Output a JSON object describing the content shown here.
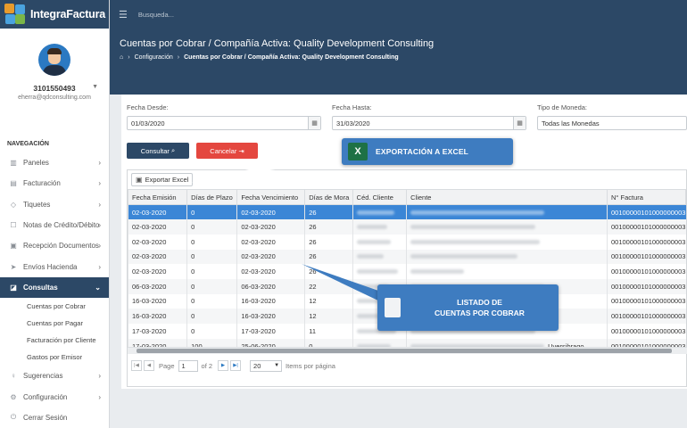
{
  "brand": {
    "name": "IntegraFactura"
  },
  "topbar": {
    "search_placeholder": "Busqueda..."
  },
  "user": {
    "id": "3101550493",
    "email": "eherra@qdconsulting.com"
  },
  "nav": {
    "heading": "NAVEGACIÓN",
    "items": [
      {
        "label": "Paneles",
        "icon": "chart-icon"
      },
      {
        "label": "Facturación",
        "icon": "invoice-icon"
      },
      {
        "label": "Tiquetes",
        "icon": "ticket-icon"
      },
      {
        "label": "Notas de Crédito/Débito",
        "icon": "notes-icon"
      },
      {
        "label": "Recepción Documentos",
        "icon": "inbox-icon"
      },
      {
        "label": "Envíos Hacienda",
        "icon": "send-icon"
      },
      {
        "label": "Consultas",
        "icon": "search-doc-icon"
      },
      {
        "label": "Sugerencias",
        "icon": "lightbulb-icon"
      },
      {
        "label": "Configuración",
        "icon": "gear-icon"
      },
      {
        "label": "Cerrar Sesión",
        "icon": "power-icon"
      }
    ],
    "subitems": [
      "Cuentas por Cobrar",
      "Cuentas por Pagar",
      "Facturación por Cliente",
      "Gastos por Emisor"
    ]
  },
  "page": {
    "title": "Cuentas por Cobrar / Compañía Activa: Quality Development Consulting",
    "breadcrumb_1": "Configuración",
    "breadcrumb_2": "Cuentas por Cobrar / Compañía Activa: Quality Development Consulting"
  },
  "filters": {
    "desde_label": "Fecha Desde:",
    "desde_value": "01/03/2020",
    "hasta_label": "Fecha Hasta:",
    "hasta_value": "31/03/2020",
    "moneda_label": "Tipo de Moneda:",
    "moneda_value": "Todas las Monedas",
    "consultar": "Consultar",
    "cancelar": "Cancelar"
  },
  "grid": {
    "export_label": "Exportar Excel",
    "columns": [
      "Fecha Emisión",
      "Días de Plazo",
      "Fecha Vencimiento",
      "Días de Mora",
      "Céd. Cliente",
      "Cliente",
      "N° Factura"
    ],
    "rows": [
      [
        "02-03-2020",
        "0",
        "02-03-2020",
        "26",
        "",
        "",
        "00100000101000000003"
      ],
      [
        "02-03-2020",
        "0",
        "02-03-2020",
        "26",
        "",
        "",
        "00100000101000000003"
      ],
      [
        "02-03-2020",
        "0",
        "02-03-2020",
        "26",
        "",
        "",
        "00100000101000000003"
      ],
      [
        "02-03-2020",
        "0",
        "02-03-2020",
        "26",
        "",
        "",
        "00100000101000000003"
      ],
      [
        "02-03-2020",
        "0",
        "02-03-2020",
        "26",
        "",
        "",
        "00100000101000000003"
      ],
      [
        "06-03-2020",
        "0",
        "06-03-2020",
        "22",
        "",
        "",
        "00100000101000000003"
      ],
      [
        "16-03-2020",
        "0",
        "16-03-2020",
        "12",
        "",
        "",
        "00100000101000000003"
      ],
      [
        "16-03-2020",
        "0",
        "16-03-2020",
        "12",
        "",
        "",
        "00100000101000000003"
      ],
      [
        "17-03-2020",
        "0",
        "17-03-2020",
        "11",
        "",
        "",
        "00100000101000000003"
      ],
      [
        "17-03-2020",
        "100",
        "25-06-2020",
        "0",
        "",
        "Uversibrago",
        "00100000101000000003"
      ]
    ],
    "pager": {
      "page_label": "Page",
      "page_value": "1",
      "of_label": "of 2",
      "page_size": "20",
      "items_label": "Items por página"
    }
  },
  "callouts": {
    "export": "EXPORTACIÓN A EXCEL",
    "list_line1": "LISTADO DE",
    "list_line2": "CUENTAS POR COBRAR"
  },
  "colors": {
    "navy": "#2c4866",
    "accent_blue": "#3e7cc0",
    "selected_row": "#3b86d6",
    "cancel_red": "#e4473f",
    "excel_green": "#1e7145"
  }
}
